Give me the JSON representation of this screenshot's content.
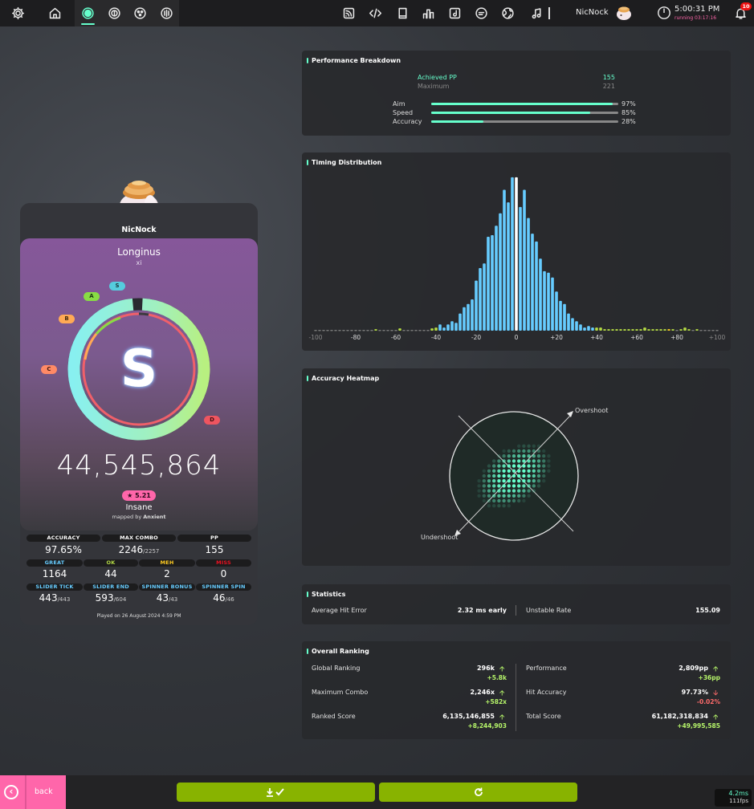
{
  "topbar": {
    "left_icons": [
      "settings-icon",
      "home-icon",
      "osu-ruleset-icon",
      "taiko-ruleset-icon",
      "catch-ruleset-icon",
      "mania-ruleset-icon"
    ],
    "right_icons": [
      "news-icon",
      "dev-icon",
      "wiki-icon",
      "rankings-icon",
      "beatmap-listing-icon",
      "chat-icon",
      "world-icon",
      "music-icon"
    ],
    "username": "NicNock",
    "clock_time": "5:00:31 PM",
    "clock_running": "running 03:17:16",
    "notification_count": "10"
  },
  "player": {
    "name": "NicNock"
  },
  "score_card": {
    "title": "Longinus",
    "artist": "xi",
    "rank": "S",
    "rank_labels": [
      "S",
      "A",
      "B",
      "C",
      "D"
    ],
    "score": "44,545,864",
    "star_rating": "★ 5.21",
    "difficulty": "Insane",
    "mapped_by_prefix": "mapped by",
    "mapper": "Anxient",
    "played_on": "Played on 26 August 2024 4:59 PM",
    "stats_row1": [
      {
        "label": "ACCURACY",
        "value": "97.65%",
        "sub": "",
        "color": "#ffffff"
      },
      {
        "label": "MAX COMBO",
        "value": "2246",
        "sub": "/2257",
        "color": "#ffffff"
      },
      {
        "label": "PP",
        "value": "155",
        "sub": "",
        "color": "#ffffff"
      }
    ],
    "stats_row2": [
      {
        "label": "GREAT",
        "value": "1164",
        "color": "#66ccff"
      },
      {
        "label": "OK",
        "value": "44",
        "color": "#b3d944"
      },
      {
        "label": "MEH",
        "value": "2",
        "color": "#ffcc22"
      },
      {
        "label": "MISS",
        "value": "0",
        "color": "#ed1121"
      }
    ],
    "stats_row3": [
      {
        "label": "SLIDER TICK",
        "value": "443",
        "sub": "/443",
        "color": "#66ccff"
      },
      {
        "label": "SLIDER END",
        "value": "593",
        "sub": "/604",
        "color": "#66ccff"
      },
      {
        "label": "SPINNER BONUS",
        "value": "43",
        "sub": "/43",
        "color": "#66ccff"
      },
      {
        "label": "SPINNER SPIN",
        "value": "46",
        "sub": "/46",
        "color": "#66ccff"
      }
    ]
  },
  "performance": {
    "title": "Performance Breakdown",
    "achieved_label": "Achieved PP",
    "achieved_value": "155",
    "maximum_label": "Maximum",
    "maximum_value": "221",
    "bars": [
      {
        "label": "Aim",
        "value": "97%",
        "fraction": 0.97
      },
      {
        "label": "Speed",
        "value": "85%",
        "fraction": 0.85
      },
      {
        "label": "Accuracy",
        "value": "28%",
        "fraction": 0.28
      }
    ]
  },
  "timing": {
    "title": "Timing Distribution"
  },
  "chart_data": {
    "type": "bar",
    "title": "Timing Distribution",
    "x_ticks": [
      "-100",
      "-80",
      "-60",
      "-40",
      "-20",
      "0",
      "+20",
      "+40",
      "+60",
      "+80",
      "+100"
    ],
    "xlim": [
      -100,
      100
    ],
    "bin_centers": [
      -100,
      -98,
      -96,
      -94,
      -92,
      -90,
      -88,
      -86,
      -84,
      -82,
      -80,
      -78,
      -76,
      -74,
      -72,
      -70,
      -68,
      -66,
      -64,
      -62,
      -60,
      -58,
      -56,
      -54,
      -52,
      -50,
      -48,
      -46,
      -44,
      -42,
      -40,
      -38,
      -36,
      -34,
      -32,
      -30,
      -28,
      -26,
      -24,
      -22,
      -20,
      -18,
      -16,
      -14,
      -12,
      -10,
      -8,
      -6,
      -4,
      -2,
      0,
      2,
      4,
      6,
      8,
      10,
      12,
      14,
      16,
      18,
      20,
      22,
      24,
      26,
      28,
      30,
      32,
      34,
      36,
      38,
      40,
      42,
      44,
      46,
      48,
      50,
      52,
      54,
      56,
      58,
      60,
      62,
      64,
      66,
      68,
      70,
      72,
      74,
      76,
      78,
      80,
      82,
      84,
      86,
      88,
      90,
      92,
      94,
      96,
      98,
      100
    ],
    "values": [
      1,
      1,
      1,
      1,
      1,
      1,
      1,
      1,
      1,
      1,
      1,
      1,
      1,
      1,
      1,
      2,
      1,
      1,
      1,
      1,
      1,
      3,
      1,
      1,
      1,
      1,
      1,
      1,
      1,
      3,
      4,
      8,
      4,
      8,
      12,
      10,
      22,
      30,
      34,
      40,
      64,
      80,
      86,
      120,
      122,
      134,
      150,
      180,
      164,
      196,
      196,
      158,
      180,
      144,
      124,
      114,
      92,
      76,
      74,
      68,
      50,
      38,
      34,
      22,
      16,
      12,
      8,
      4,
      6,
      4,
      4,
      4,
      2,
      2,
      2,
      2,
      2,
      2,
      2,
      2,
      2,
      2,
      4,
      2,
      2,
      2,
      2,
      2,
      2,
      2,
      1,
      2,
      4,
      2,
      1,
      2,
      1,
      1,
      1,
      1,
      1
    ],
    "ylim": [
      0,
      200
    ]
  },
  "heatmap": {
    "title": "Accuracy Heatmap",
    "overshoot_label": "Overshoot",
    "undershoot_label": "Undershoot"
  },
  "statistics": {
    "title": "Statistics",
    "items": [
      {
        "label": "Average Hit Error",
        "value": "2.32 ms early"
      },
      {
        "label": "Unstable Rate",
        "value": "155.09"
      }
    ]
  },
  "ranking": {
    "title": "Overall Ranking",
    "left": [
      {
        "label": "Global Ranking",
        "value": "296k",
        "delta": "+5.8k",
        "dir": "up"
      },
      {
        "label": "Maximum Combo",
        "value": "2,246x",
        "delta": "+582x",
        "dir": "up"
      },
      {
        "label": "Ranked Score",
        "value": "6,135,146,855",
        "delta": "+8,244,903",
        "dir": "up"
      }
    ],
    "right": [
      {
        "label": "Performance",
        "value": "2,809pp",
        "delta": "+36pp",
        "dir": "up"
      },
      {
        "label": "Hit Accuracy",
        "value": "97.73%",
        "delta": "-0.02%",
        "dir": "down"
      },
      {
        "label": "Total Score",
        "value": "61,182,318,834",
        "delta": "+49,995,585",
        "dir": "up"
      }
    ]
  },
  "bottom": {
    "back_label": "back",
    "frame_time": "4.2ms",
    "fps": "111fps"
  }
}
